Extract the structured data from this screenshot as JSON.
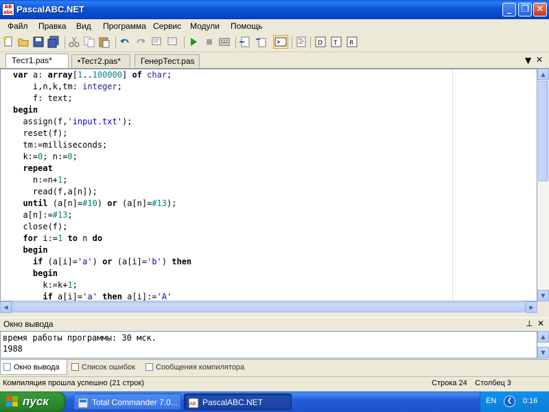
{
  "window": {
    "title": "PascalABC.NET"
  },
  "menu": [
    "Файл",
    "Правка",
    "Вид",
    "Программа",
    "Сервис",
    "Модули",
    "Помощь"
  ],
  "tabs": [
    {
      "label": "Тест1.pas*",
      "active": true
    },
    {
      "label": "•Тест2.pas*",
      "active": false
    },
    {
      "label": "ГенерТест.pas",
      "active": false
    }
  ],
  "editor": {
    "lines": [
      [
        [
          "kw",
          "var"
        ],
        [
          "",
          " a: "
        ],
        [
          "kw",
          "array"
        ],
        [
          "",
          "["
        ],
        [
          "num",
          "1"
        ],
        [
          "",
          ".."
        ],
        [
          "num",
          "100000"
        ],
        [
          "",
          "] "
        ],
        [
          "kw",
          "of"
        ],
        [
          "",
          " "
        ],
        [
          "ty",
          "char"
        ],
        [
          "",
          ";"
        ]
      ],
      [
        [
          "",
          "    i,n,k,tm: "
        ],
        [
          "ty",
          "integer"
        ],
        [
          "",
          ";"
        ]
      ],
      [
        [
          "",
          "    f: text;"
        ]
      ],
      [
        [
          "kw",
          "begin"
        ]
      ],
      [
        [
          "",
          "  assign(f,"
        ],
        [
          "str",
          "'input.txt'"
        ],
        [
          "",
          ");"
        ]
      ],
      [
        [
          "",
          "  reset(f);"
        ]
      ],
      [
        [
          "",
          "  tm:=milliseconds;"
        ]
      ],
      [
        [
          "",
          "  k:="
        ],
        [
          "num",
          "0"
        ],
        [
          "",
          "; n:="
        ],
        [
          "num",
          "0"
        ],
        [
          "",
          ";"
        ]
      ],
      [
        [
          "",
          "  "
        ],
        [
          "kw",
          "repeat"
        ]
      ],
      [
        [
          "",
          "    n:=n+"
        ],
        [
          "num",
          "1"
        ],
        [
          "",
          ";"
        ]
      ],
      [
        [
          "",
          "    read(f,a[n]);"
        ]
      ],
      [
        [
          "",
          "  "
        ],
        [
          "kw",
          "until"
        ],
        [
          "",
          " (a[n]="
        ],
        [
          "num",
          "#10"
        ],
        [
          "",
          ") "
        ],
        [
          "kw",
          "or"
        ],
        [
          "",
          " (a[n]="
        ],
        [
          "num",
          "#13"
        ],
        [
          "",
          ");"
        ]
      ],
      [
        [
          "",
          "  a[n]:="
        ],
        [
          "num",
          "#13"
        ],
        [
          "",
          ";"
        ]
      ],
      [
        [
          "",
          "  close(f);"
        ]
      ],
      [
        [
          "",
          "  "
        ],
        [
          "kw",
          "for"
        ],
        [
          "",
          " i:="
        ],
        [
          "num",
          "1"
        ],
        [
          "",
          " "
        ],
        [
          "kw",
          "to"
        ],
        [
          "",
          " n "
        ],
        [
          "kw",
          "do"
        ]
      ],
      [
        [
          "",
          "  "
        ],
        [
          "kw",
          "begin"
        ]
      ],
      [
        [
          "",
          "    "
        ],
        [
          "kw",
          "if"
        ],
        [
          "",
          " (a[i]="
        ],
        [
          "str",
          "'a'"
        ],
        [
          "",
          ") "
        ],
        [
          "kw",
          "or"
        ],
        [
          "",
          " (a[i]="
        ],
        [
          "str",
          "'b'"
        ],
        [
          "",
          ") "
        ],
        [
          "kw",
          "then"
        ]
      ],
      [
        [
          "",
          "    "
        ],
        [
          "kw",
          "begin"
        ]
      ],
      [
        [
          "",
          "      k:=k+"
        ],
        [
          "num",
          "1"
        ],
        [
          "",
          ";"
        ]
      ],
      [
        [
          "",
          "      "
        ],
        [
          "kw",
          "if"
        ],
        [
          "",
          " a[i]="
        ],
        [
          "str",
          "'a'"
        ],
        [
          "",
          " "
        ],
        [
          "kw",
          "then"
        ],
        [
          "",
          " a[i]:="
        ],
        [
          "str",
          "'A'"
        ]
      ]
    ]
  },
  "output": {
    "title": "Окно вывода",
    "lines": [
      "время работы программы: 30 мск.",
      "1988"
    ]
  },
  "bottom_tabs": [
    "Окно вывода",
    "Список ошибок",
    "Сообщения компилятора"
  ],
  "status": {
    "message": "Компиляция прошла успешно (21 строк)",
    "row": "Строка  24",
    "col": "Столбец  3"
  },
  "taskbar": {
    "start": "пуск",
    "tasks": [
      "Total Commander 7.0...",
      "PascalABC.NET"
    ],
    "lang": "EN",
    "clock": "0:16"
  },
  "colors": {
    "keyword": "#000000",
    "type": "#1a1aa6",
    "number": "#008080",
    "string": "#0000c0",
    "titlebar": "#0A56D8"
  }
}
